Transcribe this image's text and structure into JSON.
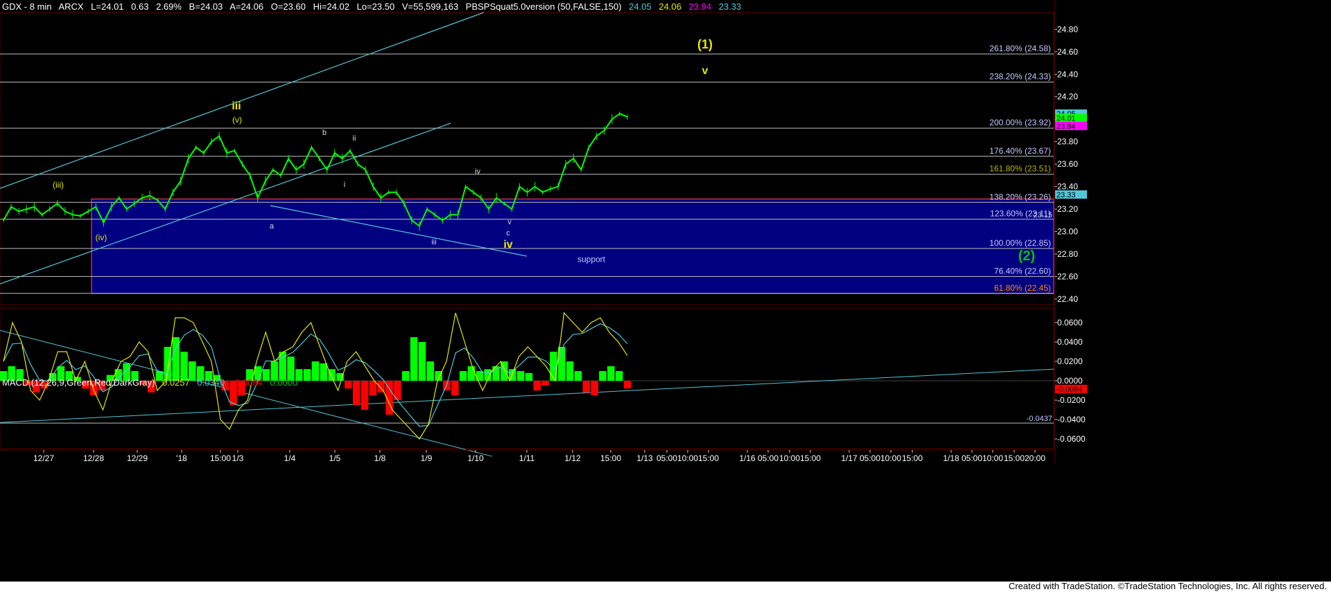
{
  "header": {
    "symbol": "GDX - 8 min",
    "exchange": "ARCX",
    "last": "L=24.01",
    "change": "0.63",
    "pct": "2.69%",
    "bid": "B=24.03",
    "ask": "A=24.06",
    "open": "O=23.60",
    "high": "Hi=24.02",
    "low": "Lo=23.50",
    "volume": "V=55,599,163",
    "indicator": "PBSPSquat5.0version (50,FALSE,150)",
    "ind_v1": "24.05",
    "ind_v2": "24.06",
    "ind_v3": "23.94",
    "ind_v4": "23.33"
  },
  "macd_header": {
    "label": "MACD (12,26,9,Green,Red,DarkGray)",
    "v1": "0.0257",
    "v2": "0.0340",
    "v3": "-0.0084",
    "v4": "0.0000"
  },
  "footer": {
    "text": "Created with TradeStation. ©TradeStation Technologies, Inc. All rights reserved."
  },
  "colors": {
    "background": "#000000",
    "price_up": "#00ff00",
    "fib_line": "#c0c0c0",
    "fib_label": "#c8c8ff",
    "fib_label_gold": "#b4b400",
    "fib_label_orange": "#ff8c00",
    "channel": "#4fc8d8",
    "support_zone": "#000080",
    "support_border": "#c0304a",
    "wave_yellow": "#e8e800",
    "wave_green": "#00c800",
    "wave_white": "#d8d8e8",
    "macd_up": "#00ff00",
    "macd_down": "#ff0000",
    "macd_line": "#e8e800",
    "signal_line": "#4fc8d8"
  },
  "chart_data": [
    {
      "type": "line",
      "title": "GDX - 8 min",
      "ylim": [
        22.35,
        24.95
      ],
      "y_ticks": [
        "24.80",
        "24.60",
        "24.40",
        "24.20",
        "24.00",
        "23.80",
        "23.60",
        "23.40",
        "23.20",
        "23.00",
        "22.80",
        "22.60",
        "22.40"
      ],
      "x_ticks": [
        "12/27",
        "12/28",
        "12/29",
        "'18",
        "15:00",
        "1/3",
        "1/4",
        "1/5",
        "1/8",
        "1/9",
        "1/10",
        "1/11",
        "1/12",
        "15:00",
        "1/13",
        "05:00",
        "10:00",
        "15:00",
        "1/16",
        "05:00",
        "10:00",
        "15:00",
        "1/17",
        "05:00",
        "10:00",
        "15:00",
        "1/18",
        "05:00",
        "10:00",
        "15:00",
        "20:00"
      ],
      "fib_levels": [
        {
          "label": "261.80% (24.58)",
          "value": 24.58,
          "color": "#c8c8ff"
        },
        {
          "label": "238.20% (24.33)",
          "value": 24.33,
          "color": "#c8c8ff"
        },
        {
          "label": "200.00% (23.92)",
          "value": 23.92,
          "color": "#c8c8ff"
        },
        {
          "label": "176.40% (23.67)",
          "value": 23.67,
          "color": "#c8c8ff"
        },
        {
          "label": "161.80% (23.51)",
          "value": 23.51,
          "color": "#b4b400"
        },
        {
          "label": "138.20% (23.26)",
          "value": 23.26,
          "color": "#c8c8ff"
        },
        {
          "label": "123.60% (23.11)",
          "value": 23.11,
          "color": "#c8c8ff"
        },
        {
          "label": "100.00% (22.85)",
          "value": 22.85,
          "color": "#c8c8ff"
        },
        {
          "label": "76.40% (22.60)",
          "value": 22.6,
          "color": "#c8c8ff"
        },
        {
          "label": "61.80% (22.45)",
          "value": 22.45,
          "color": "#ff8c00"
        }
      ],
      "support_zone": {
        "label": "support",
        "from": 22.45,
        "to": 23.29
      },
      "price_tags": [
        {
          "label": "24.05",
          "value": 24.05,
          "bg": "#4fc8d8"
        },
        {
          "label": "24.01",
          "value": 24.01,
          "bg": "#00ff00"
        },
        {
          "label": "23.94",
          "value": 23.94,
          "bg": "#ff00ff"
        },
        {
          "label": "23.33",
          "value": 23.33,
          "bg": "#4fc8d8"
        },
        {
          "label": "23.15",
          "value": 23.15,
          "bg": ""
        }
      ],
      "wave_labels": [
        {
          "text": "(1)",
          "style": "yellow-large"
        },
        {
          "text": "v",
          "style": "yellow-large"
        },
        {
          "text": "iii",
          "style": "yellow-large"
        },
        {
          "text": "(v)",
          "style": "yellow"
        },
        {
          "text": "(iii)",
          "style": "yellow"
        },
        {
          "text": "(iv)",
          "style": "yellow"
        },
        {
          "text": "iv",
          "style": "yellow-large"
        },
        {
          "text": "(2)",
          "style": "green-large"
        },
        {
          "text": "a",
          "style": "white"
        },
        {
          "text": "b",
          "style": "white"
        },
        {
          "text": "c",
          "style": "white"
        },
        {
          "text": "i",
          "style": "white"
        },
        {
          "text": "ii",
          "style": "white"
        },
        {
          "text": "iii",
          "style": "white"
        },
        {
          "text": "iv",
          "style": "white"
        },
        {
          "text": "v",
          "style": "white"
        }
      ],
      "series": [
        {
          "name": "GDX",
          "values": [
            23.1,
            23.22,
            23.18,
            23.2,
            23.22,
            23.15,
            23.2,
            23.25,
            23.18,
            23.15,
            23.14,
            23.18,
            23.22,
            23.08,
            23.22,
            23.3,
            23.2,
            23.25,
            23.3,
            23.32,
            23.28,
            23.2,
            23.35,
            23.45,
            23.65,
            23.75,
            23.7,
            23.8,
            23.85,
            23.7,
            23.72,
            23.6,
            23.5,
            23.3,
            23.45,
            23.55,
            23.5,
            23.65,
            23.55,
            23.6,
            23.75,
            23.65,
            23.55,
            23.7,
            23.65,
            23.72,
            23.6,
            23.55,
            23.4,
            23.3,
            23.35,
            23.35,
            23.25,
            23.1,
            23.05,
            23.2,
            23.15,
            23.1,
            23.15,
            23.15,
            23.4,
            23.35,
            23.3,
            23.2,
            23.3,
            23.25,
            23.2,
            23.4,
            23.35,
            23.4,
            23.35,
            23.38,
            23.4,
            23.6,
            23.65,
            23.55,
            23.75,
            23.85,
            23.9,
            24.0,
            24.05,
            24.02
          ]
        }
      ]
    },
    {
      "type": "bar",
      "title": "MACD (12,26,9,Green,Red,DarkGray)",
      "ylim": [
        -0.07,
        0.075
      ],
      "y_ticks": [
        "0.0600",
        "0.0400",
        "0.0200",
        "0.0000",
        "-0.0200",
        "-0.0400",
        "-0.0600"
      ],
      "price_tags": [
        {
          "label": "-0.0084",
          "value": -0.0084,
          "bg": "#ff0000"
        },
        {
          "label": "-0.0437",
          "value": -0.0437,
          "bg": ""
        }
      ],
      "series": [
        {
          "name": "Histogram",
          "values": [
            0.01,
            0.015,
            0.012,
            -0.005,
            -0.012,
            -0.008,
            0.008,
            0.015,
            0.01,
            0.004,
            -0.008,
            -0.015,
            -0.01,
            0.006,
            0.012,
            0.018,
            0.01,
            -0.004,
            -0.012,
            0.01,
            0.035,
            0.045,
            0.03,
            0.02,
            0.015,
            0.01,
            0.006,
            -0.01,
            -0.025,
            -0.015,
            0.012,
            0.015,
            0.012,
            0.02,
            0.03,
            0.025,
            0.012,
            0.012,
            0.02,
            0.018,
            0.012,
            0.008,
            -0.008,
            -0.025,
            -0.03,
            -0.015,
            -0.012,
            -0.035,
            -0.02,
            0.01,
            0.045,
            0.04,
            0.02,
            0.01,
            -0.01,
            -0.015,
            0.01,
            0.015,
            0.01,
            0.012,
            0.015,
            0.02,
            0.012,
            0.01,
            0.008,
            -0.01,
            -0.005,
            0.03,
            0.035,
            0.02,
            0.01,
            -0.012,
            -0.015,
            0.01,
            0.015,
            0.01,
            -0.008
          ]
        },
        {
          "name": "MACD",
          "values": [
            0.02,
            0.06,
            0.04,
            -0.01,
            -0.02,
            0.0,
            0.03,
            0.03,
            0.0,
            0.02,
            -0.01,
            -0.03,
            0.0,
            0.02,
            0.025,
            0.04,
            0.03,
            -0.01,
            0.0,
            0.065,
            0.065,
            0.06,
            0.04,
            0.02,
            -0.04,
            -0.05,
            -0.03,
            -0.02,
            0.02,
            0.05,
            0.02,
            0.03,
            0.035,
            0.05,
            0.06,
            0.035,
            0.01,
            -0.01,
            0.02,
            0.03,
            0.015,
            0.0,
            -0.01,
            -0.03,
            -0.04,
            -0.05,
            -0.06,
            -0.045,
            0.0,
            0.02,
            0.07,
            0.04,
            0.01,
            -0.01,
            0.01,
            0.02,
            0.0,
            0.025,
            0.035,
            0.025,
            0.015,
            0.0,
            0.07,
            0.06,
            0.05,
            0.06,
            0.065,
            0.05,
            0.04,
            0.026
          ]
        }
      ]
    }
  ]
}
